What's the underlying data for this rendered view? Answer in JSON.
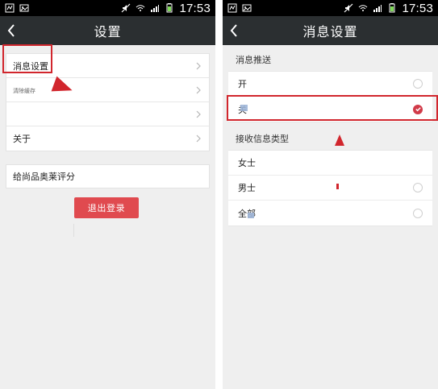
{
  "status": {
    "time_left": "17:53",
    "time_right": "17:53"
  },
  "left": {
    "title": "设置",
    "items": [
      {
        "label": "消息设置"
      },
      {
        "label": "清除缓存"
      },
      {
        "label": ""
      },
      {
        "label": "关于"
      }
    ],
    "rating_label": "给尚品奥莱评分",
    "logout_label": "退出登录"
  },
  "right": {
    "title": "消息设置",
    "push_section_title": "消息推送",
    "push_options": [
      {
        "label": "开"
      },
      {
        "label": "关"
      }
    ],
    "type_section_title": "接收信息类型",
    "type_options": [
      {
        "label": "女士"
      },
      {
        "label": "男士"
      },
      {
        "label": "全部"
      }
    ]
  },
  "colors": {
    "topbar": "#2b2f31",
    "status": "#000000",
    "accent_red": "#d1262d",
    "logout": "#e04a4f"
  },
  "icons": {
    "back": "chevron-left-icon",
    "chevron": "chevron-right-icon",
    "wifi": "wifi-icon",
    "signal": "signal-icon",
    "battery": "battery-icon",
    "mute": "mute-icon"
  }
}
